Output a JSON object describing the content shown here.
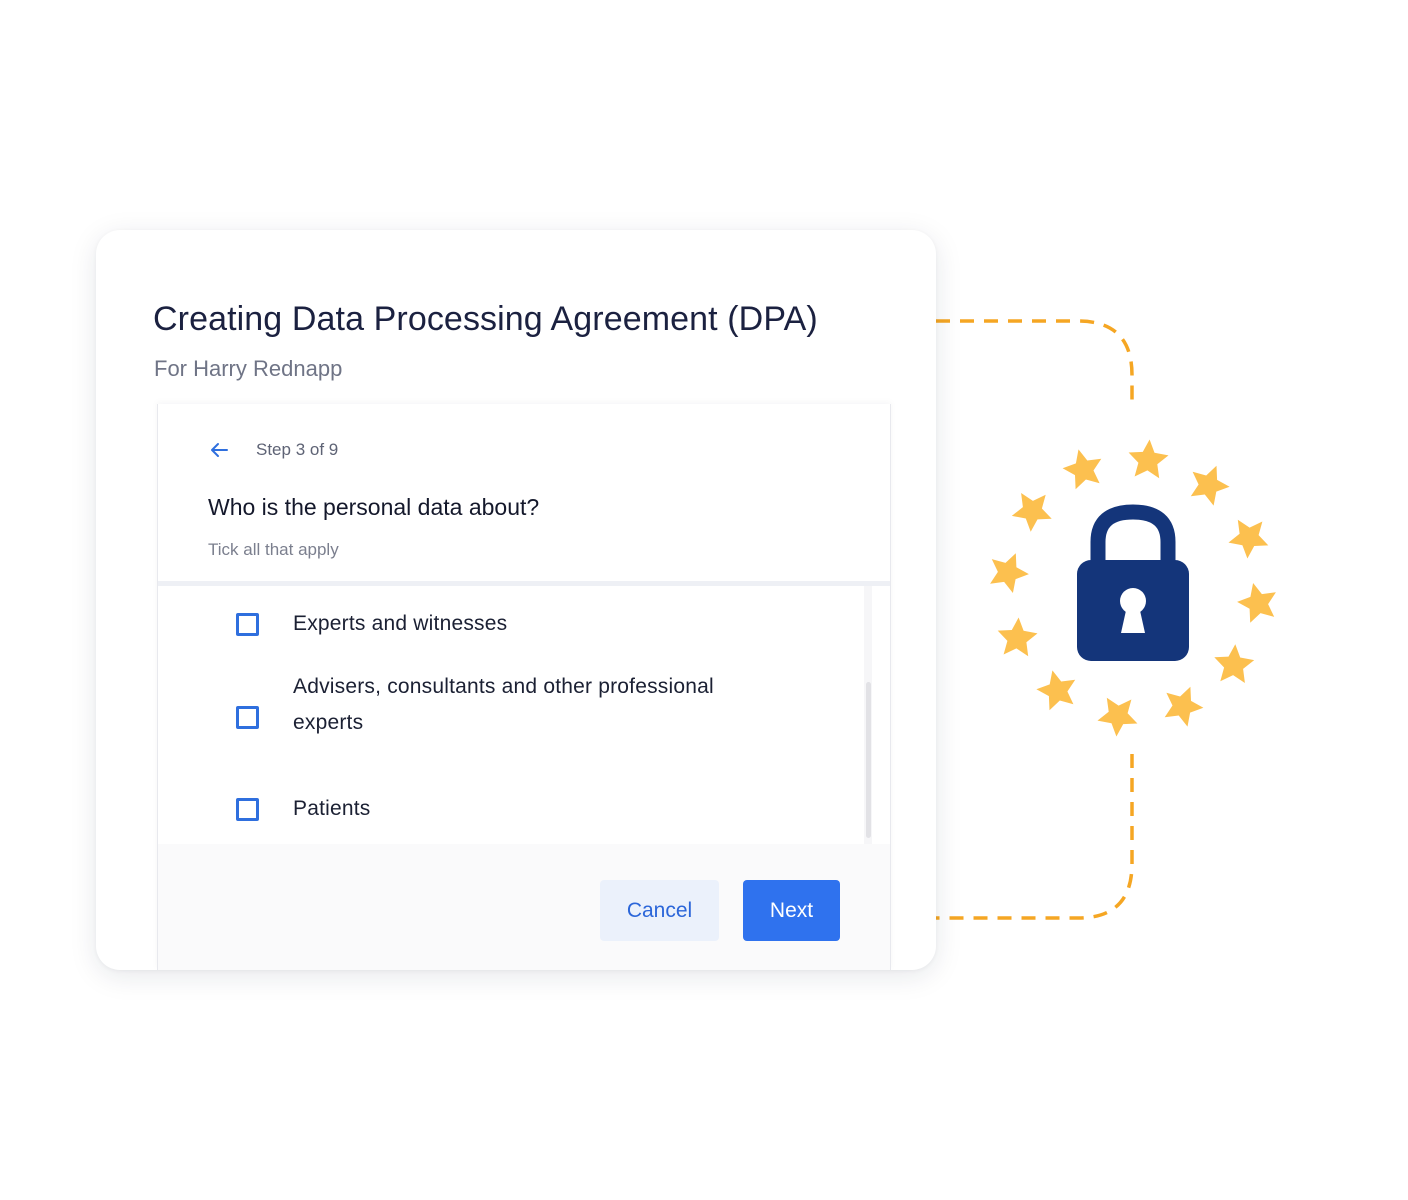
{
  "dialog": {
    "title": "Creating Data Processing Agreement (DPA)",
    "subtitle": "For Harry Rednapp"
  },
  "wizard": {
    "back_icon": "arrow-left-icon",
    "step_label": "Step 3 of 9",
    "question": "Who is the personal data about?",
    "hint": "Tick all that apply",
    "options": [
      {
        "label": "Experts and witnesses",
        "checked": false
      },
      {
        "label": "Advisers, consultants and other professional experts",
        "checked": false
      },
      {
        "label": "Patients",
        "checked": false
      }
    ]
  },
  "footer": {
    "cancel_label": "Cancel",
    "next_label": "Next"
  },
  "illustration": {
    "icon": "padlock-icon",
    "star_icon": "star-icon",
    "star_count": 12
  },
  "colors": {
    "accent": "#2f72ee",
    "checkbox": "#2f6fde",
    "lock": "#14357a",
    "stars": "#fcc04f",
    "connector": "#f5a623"
  }
}
